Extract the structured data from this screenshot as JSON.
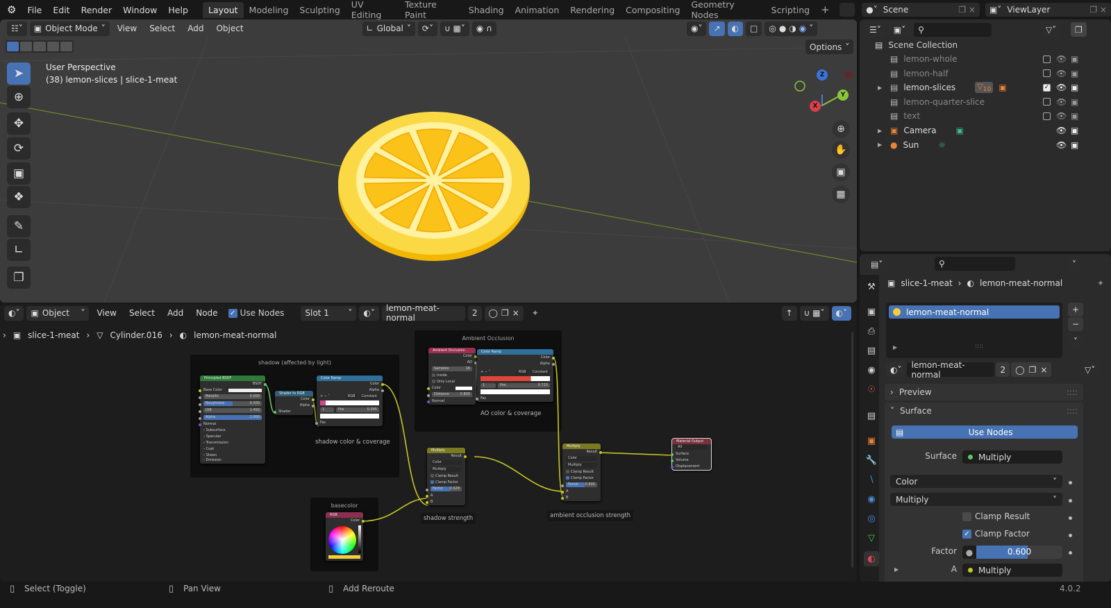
{
  "topbar": {
    "menus": [
      "File",
      "Edit",
      "Render",
      "Window",
      "Help"
    ],
    "workspaces": [
      "Layout",
      "Modeling",
      "Sculpting",
      "UV Editing",
      "Texture Paint",
      "Shading",
      "Animation",
      "Rendering",
      "Compositing",
      "Geometry Nodes",
      "Scripting"
    ],
    "add_workspace": "+",
    "scene": "Scene",
    "view_layer": "ViewLayer"
  },
  "viewport": {
    "mode": "Object Mode",
    "menus": [
      "View",
      "Select",
      "Add",
      "Object"
    ],
    "orientation": "Global",
    "options": "Options",
    "perspective": "User Perspective",
    "object_info": "(38) lemon-slices | slice-1-meat",
    "axes": {
      "x": "X",
      "y": "Y",
      "z": "Z"
    }
  },
  "node_editor": {
    "type": "Object",
    "menus": [
      "View",
      "Select",
      "Add",
      "Node"
    ],
    "use_nodes": "Use Nodes",
    "slot": "Slot 1",
    "material": "lemon-meat-normal",
    "users": "2",
    "breadcrumb": [
      "slice-1-meat",
      "Cylinder.016",
      "lemon-meat-normal"
    ],
    "frames": {
      "shadow": "shadow (affected by light)",
      "ao": "Ambient Occlusion",
      "basecolor": "basecolor"
    },
    "labels": {
      "shadow_ramp": "shadow color & coverage",
      "ao_ramp": "AO color & coverage",
      "mult1": "shadow strength",
      "mult2": "ambient occlusion strength"
    },
    "bsdf": {
      "title": "Principled BSDF",
      "output": "BSDF",
      "base_color": "Base Color",
      "metallic": "Metallic",
      "metallic_v": "0.000",
      "roughness": "Roughness",
      "roughness_v": "0.500",
      "ior": "IOR",
      "ior_v": "1.450",
      "alpha": "Alpha",
      "alpha_v": "1.000",
      "normal": "Normal",
      "panels": [
        "Subsurface",
        "Specular",
        "Transmission",
        "Coat",
        "Sheen",
        "Emission"
      ]
    },
    "shader_to_rgb": {
      "title": "Shader to RGB",
      "color": "Color",
      "alpha": "Alpha",
      "shader": "Shader"
    },
    "ramp1": {
      "title": "Color Ramp",
      "color": "Color",
      "alpha": "Alpha",
      "mode": "RGB",
      "interp": "Constant",
      "index": "1",
      "pos": "Pos",
      "pos_v": "0.095",
      "fac": "Fac"
    },
    "ao": {
      "title": "Ambient Occlusion",
      "color": "Color",
      "ao": "AO",
      "samples": "Samples",
      "samples_v": "16",
      "inside": "Inside",
      "only_local": "Only Local",
      "color_in": "Color",
      "distance": "Distance",
      "distance_v": "0.800",
      "normal": "Normal"
    },
    "ramp2": {
      "title": "Color Ramp",
      "color": "Color",
      "alpha": "Alpha",
      "mode": "RGB",
      "interp": "Constant",
      "index": "1",
      "pos": "Pos",
      "pos_v": "0.723",
      "fac": "Fac"
    },
    "mult1": {
      "title": "Multiply",
      "result": "Result",
      "type": "Color",
      "op": "Multiply",
      "clamp_result": "Clamp Result",
      "clamp_factor": "Clamp Factor",
      "factor": "Factor",
      "factor_v": "0.628",
      "a": "A",
      "b": "B"
    },
    "mult2": {
      "title": "Multiply",
      "result": "Result",
      "type": "Color",
      "op": "Multiply",
      "clamp_result": "Clamp Result",
      "clamp_factor": "Clamp Factor",
      "factor": "Factor",
      "factor_v": "0.600",
      "a": "A",
      "b": "B"
    },
    "output": {
      "title": "Material Output",
      "target": "All",
      "surface": "Surface",
      "volume": "Volume",
      "displacement": "Displacement"
    },
    "rgb": {
      "title": "RGB",
      "color": "Color",
      "swatch": "#f5cf3a"
    }
  },
  "outliner": {
    "root": "Scene Collection",
    "items": [
      {
        "name": "lemon-whole",
        "checked": false
      },
      {
        "name": "lemon-half",
        "checked": false
      },
      {
        "name": "lemon-slices",
        "checked": true,
        "badge": "10"
      },
      {
        "name": "lemon-quarter-slice",
        "checked": false
      },
      {
        "name": "text",
        "checked": false
      },
      {
        "name": "Camera"
      },
      {
        "name": "Sun"
      }
    ]
  },
  "properties": {
    "object": "slice-1-meat",
    "material": "lemon-meat-normal",
    "slot_item": "lemon-meat-normal",
    "users": "2",
    "preview": "Preview",
    "surface_panel": "Surface",
    "use_nodes": "Use Nodes",
    "surface_label": "Surface",
    "surface_value": "Multiply",
    "type": "Color",
    "op": "Multiply",
    "clamp_result": "Clamp Result",
    "clamp_factor": "Clamp Factor",
    "factor_label": "Factor",
    "factor_value": "0.600",
    "factor": 0.6,
    "a_label": "A",
    "a_value": "Multiply"
  },
  "statusbar": {
    "items": [
      "Select (Toggle)",
      "Pan View",
      "Add Reroute"
    ],
    "version": "4.0.2"
  },
  "colors": {
    "accent": "#4772b3",
    "socket_color": "#c7c729",
    "socket_shader": "#63c763",
    "lemon": "#f7d63a"
  }
}
